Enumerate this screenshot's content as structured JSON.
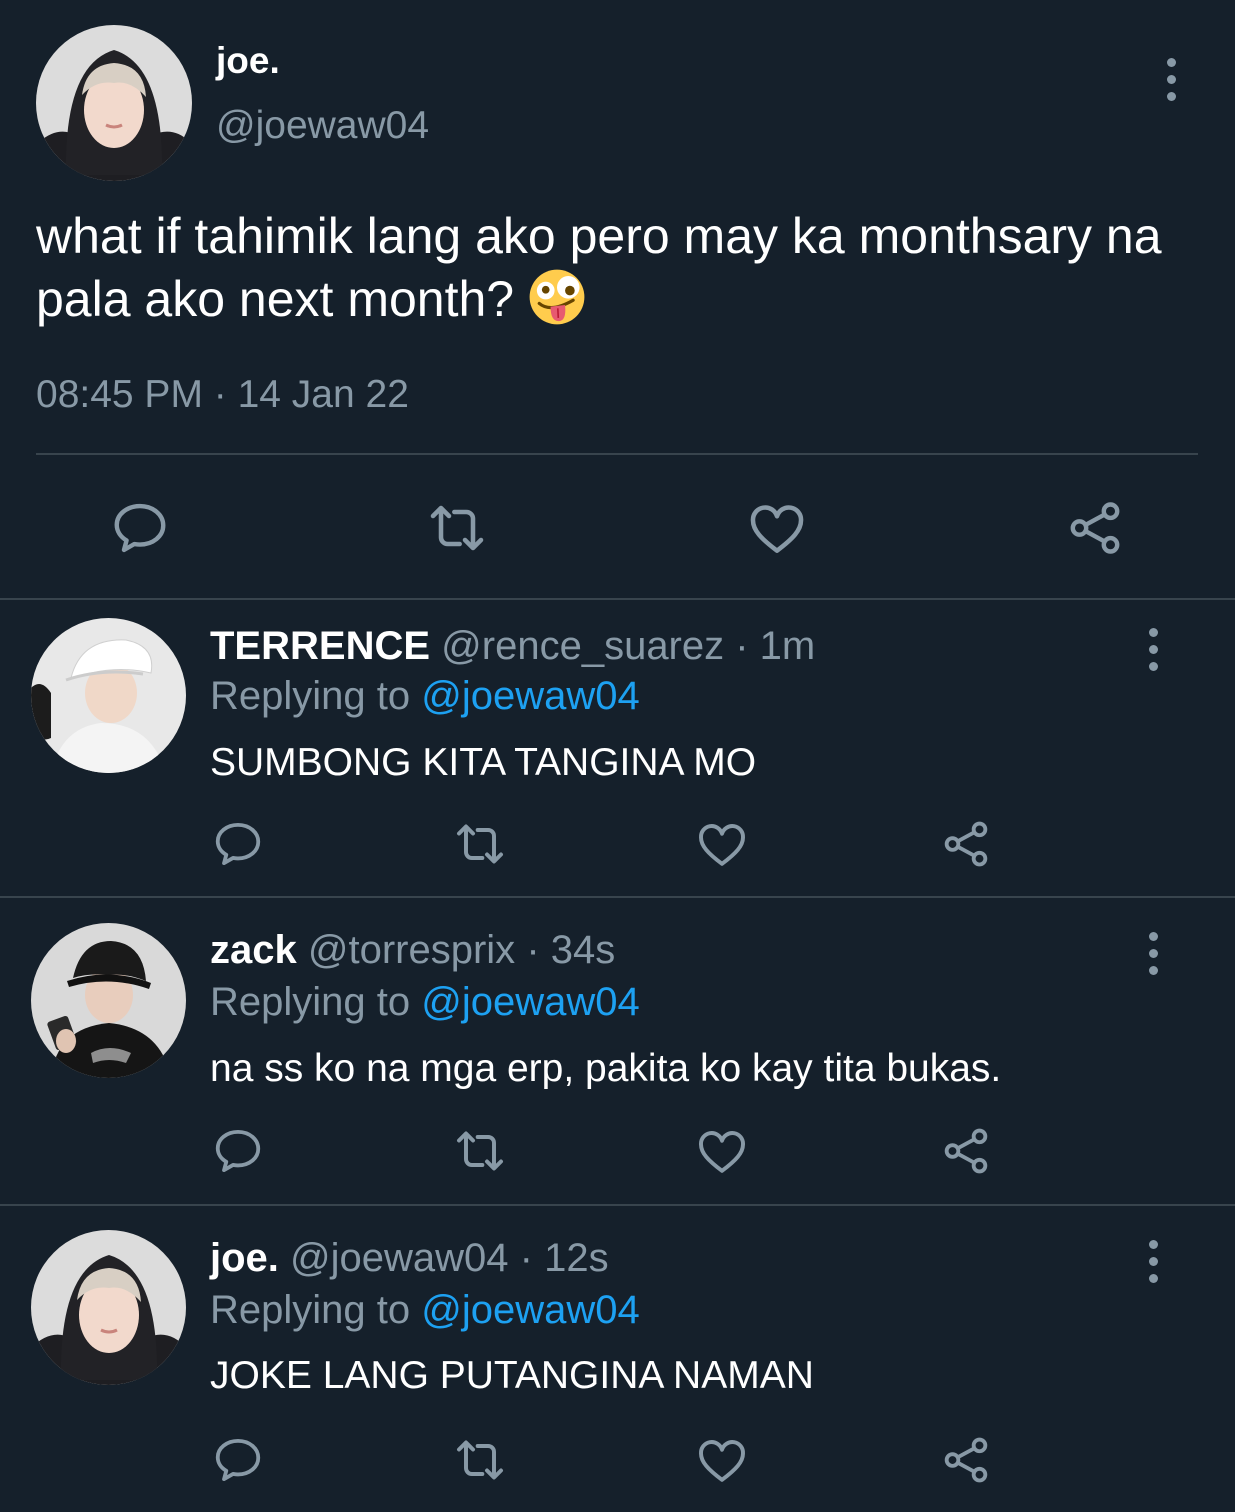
{
  "main_tweet": {
    "display_name": "joe.",
    "handle": "@joewaw04",
    "text": "what if tahimik lang ako pero may ka monthsary na pala ako next month?",
    "emoji": "zany-face-emoji",
    "timestamp": "08:45 PM · 14 Jan 22",
    "actions": [
      "reply-icon",
      "retweet-icon",
      "like-icon",
      "share-icon"
    ]
  },
  "replies": [
    {
      "display_name": "TERRENCE",
      "handle": "@rence_suarez",
      "time": "· 1m",
      "replying_prefix": "Replying to",
      "replying_to": "@joewaw04",
      "text": "SUMBONG KITA TANGINA MO"
    },
    {
      "display_name": "zack",
      "handle": "@torresprix",
      "time": "· 34s",
      "replying_prefix": "Replying to",
      "replying_to": "@joewaw04",
      "text": "na ss ko na mga erp, pakita ko kay tita bukas."
    },
    {
      "display_name": "joe.",
      "handle": "@joewaw04",
      "time": "· 12s",
      "replying_prefix": "Replying to",
      "replying_to": "@joewaw04",
      "text": "JOKE LANG PUTANGINA NAMAN"
    }
  ],
  "colors": {
    "background": "#15202b",
    "secondary_text": "#8899a6",
    "link": "#1da1f2",
    "divider": "#38444d"
  }
}
